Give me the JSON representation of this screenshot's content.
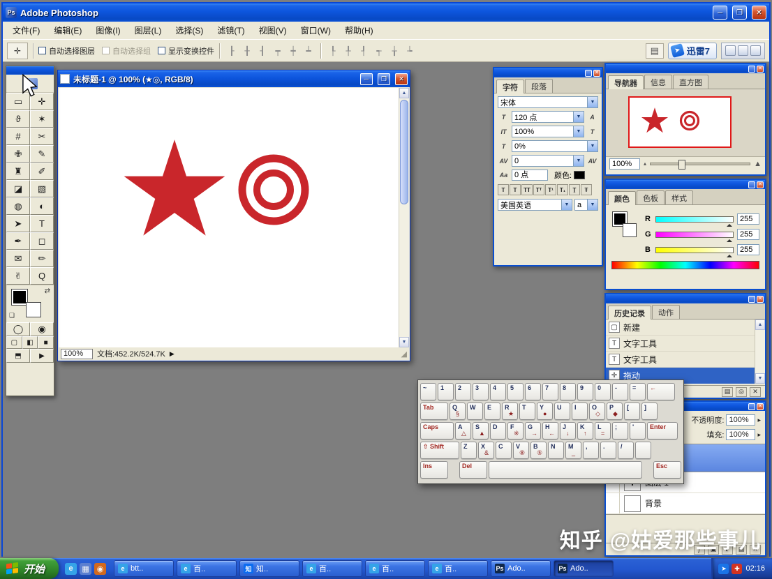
{
  "ui": {
    "up": "▲",
    "down": "▼",
    "right": "▶",
    "spin": "▸",
    "resize": "◢",
    "swap": "⇄",
    "reset": "❏",
    "dd": "▼"
  },
  "app": {
    "title": "Adobe Photoshop",
    "icon_label": "Ps",
    "minimize": "─",
    "restore": "❐",
    "close": "✕"
  },
  "menu": {
    "items": [
      "文件(F)",
      "编辑(E)",
      "图像(I)",
      "图层(L)",
      "选择(S)",
      "滤镜(T)",
      "视图(V)",
      "窗口(W)",
      "帮助(H)"
    ]
  },
  "options": {
    "tool_glyph": "✛",
    "checkboxes": [
      {
        "label": "自动选择图层"
      },
      {
        "label": "自动选择组",
        "cls": "disabled"
      },
      {
        "label": "显示变换控件"
      }
    ],
    "align_icons": [
      "┠",
      "╂",
      "┨",
      "┯",
      "┿",
      "┷"
    ],
    "dist_icons": [
      "┞",
      "╀",
      "┦",
      "┭",
      "╁",
      "┶"
    ],
    "browser_glyph": "▤",
    "thunder_label": "迅雷7",
    "thunder_logo": "➤"
  },
  "toolbox": {
    "tools": [
      {
        "name": "rectangular-marquee-tool",
        "glyph": "▭"
      },
      {
        "name": "move-tool",
        "glyph": "✛"
      },
      {
        "name": "lasso-tool",
        "glyph": "ϑ"
      },
      {
        "name": "magic-wand-tool",
        "glyph": "✶"
      },
      {
        "name": "crop-tool",
        "glyph": "#"
      },
      {
        "name": "slice-tool",
        "glyph": "✂"
      },
      {
        "name": "healing-brush-tool",
        "glyph": "✙"
      },
      {
        "name": "brush-tool",
        "glyph": "✎"
      },
      {
        "name": "clone-stamp-tool",
        "glyph": "♜"
      },
      {
        "name": "history-brush-tool",
        "glyph": "✐"
      },
      {
        "name": "eraser-tool",
        "glyph": "◪"
      },
      {
        "name": "gradient-tool",
        "glyph": "▧"
      },
      {
        "name": "blur-tool",
        "glyph": "◍"
      },
      {
        "name": "dodge-tool",
        "glyph": "◐"
      },
      {
        "name": "path-selection-tool",
        "glyph": "➤"
      },
      {
        "name": "type-tool",
        "glyph": "T"
      },
      {
        "name": "pen-tool",
        "glyph": "✒"
      },
      {
        "name": "shape-tool",
        "glyph": "◻"
      },
      {
        "name": "notes-tool",
        "glyph": "✉"
      },
      {
        "name": "eyedropper-tool",
        "glyph": "✏"
      },
      {
        "name": "hand-tool",
        "glyph": "✌"
      },
      {
        "name": "zoom-tool",
        "glyph": "Q"
      }
    ],
    "quickmask": [
      "◯",
      "◉"
    ],
    "screen_modes": [
      "▢",
      "◧",
      "■"
    ],
    "jump_buttons": [
      "⬒",
      "▶"
    ]
  },
  "document": {
    "title": "未标题-1 @ 100% (★◎, RGB/8)",
    "zoom": "100%",
    "status": "文档:452.2K/524.7K",
    "art_color": "#c9262b"
  },
  "char_panel": {
    "tabs": [
      {
        "label": "字符",
        "cls": "active"
      },
      {
        "label": "段落"
      }
    ],
    "font": "宋体",
    "size": "120 点",
    "v_scale": "100%",
    "h_scale": "0%",
    "tracking": "0",
    "baseline": "0 点",
    "color_label": "颜色:",
    "language": "美国英语",
    "styles": [
      "T",
      "T",
      "TT",
      "Tᵀ",
      "T¹",
      "T₁",
      "Ṯ",
      "Ŧ"
    ],
    "icons": {
      "size": "T",
      "size2": "A",
      "vscale": "IT",
      "vscale2": "T",
      "hscale": "T",
      "tracking": "AV",
      "tracking2": "AV",
      "baseline": "Aa",
      "aa": "a"
    }
  },
  "navigator": {
    "tabs": [
      {
        "label": "导航器",
        "cls": "active"
      },
      {
        "label": "信息"
      },
      {
        "label": "直方图"
      }
    ],
    "zoom": "100%",
    "zoom_out_icon": "▴",
    "zoom_in_icon": "▲"
  },
  "color_panel": {
    "tabs": [
      {
        "label": "颜色",
        "cls": "active"
      },
      {
        "label": "色板"
      },
      {
        "label": "样式"
      }
    ],
    "sliders": [
      {
        "label": "R",
        "value": "255",
        "grad": "linear-gradient(90deg,#00ffff,#ffffff)"
      },
      {
        "label": "G",
        "value": "255",
        "grad": "linear-gradient(90deg,#ff00ff,#ffffff)"
      },
      {
        "label": "B",
        "value": "255",
        "grad": "linear-gradient(90deg,#ffff00,#ffffff)"
      }
    ]
  },
  "history": {
    "tabs": [
      {
        "label": "历史记录",
        "cls": "active"
      },
      {
        "label": "动作"
      }
    ],
    "items": [
      {
        "icon": "▢",
        "label": "新建"
      },
      {
        "icon": "T",
        "label": "文字工具"
      },
      {
        "icon": "T",
        "label": "文字工具"
      },
      {
        "icon": "✛",
        "label": "拖动",
        "cls": "selected"
      }
    ],
    "footer": [
      {
        "name": "new-document-from-state-icon",
        "glyph": "▤"
      },
      {
        "name": "new-snapshot-icon",
        "glyph": "◎"
      },
      {
        "name": "delete-state-icon",
        "glyph": "✕"
      }
    ]
  },
  "layers": {
    "opacity_label": "不透明度:",
    "opacity": "100%",
    "fill_label": "填充:",
    "fill": "100%",
    "eye_icon": "◉",
    "rows": [
      {
        "thumb": "T",
        "name": "图层 1"
      },
      {
        "thumb": "",
        "name": "背景"
      }
    ],
    "footer": [
      {
        "name": "layer-style-icon",
        "glyph": "ƒ"
      },
      {
        "name": "layer-mask-icon",
        "glyph": "▣"
      },
      {
        "name": "adjustment-layer-icon",
        "glyph": "◐"
      },
      {
        "name": "new-layer-icon",
        "glyph": "▤"
      },
      {
        "name": "delete-layer-icon",
        "glyph": "✕"
      }
    ]
  },
  "keyboard": {
    "row0": [
      {
        "t": "~"
      },
      {
        "t": "1"
      },
      {
        "t": "2"
      },
      {
        "t": "3"
      },
      {
        "t": "4"
      },
      {
        "t": "5"
      },
      {
        "t": "6"
      },
      {
        "t": "7"
      },
      {
        "t": "8"
      },
      {
        "t": "9"
      },
      {
        "t": "0"
      },
      {
        "t": "-"
      },
      {
        "t": "="
      },
      {
        "t": "←",
        "cls": "mod wide"
      }
    ],
    "row1": [
      {
        "t": "Tab",
        "cls": "mod wide"
      },
      {
        "t": "Q",
        "s": "§"
      },
      {
        "t": "W"
      },
      {
        "t": "E"
      },
      {
        "t": "R",
        "s": "★"
      },
      {
        "t": "T"
      },
      {
        "t": "Y",
        "s": "●"
      },
      {
        "t": "U"
      },
      {
        "t": "I"
      },
      {
        "t": "O",
        "s": "◇"
      },
      {
        "t": "P",
        "s": "◆"
      },
      {
        "t": "["
      },
      {
        "t": "]"
      }
    ],
    "row2": [
      {
        "t": "Caps",
        "cls": "mod wider"
      },
      {
        "t": "A",
        "s": "△"
      },
      {
        "t": "S",
        "s": "▲"
      },
      {
        "t": "D"
      },
      {
        "t": "F",
        "s": "※"
      },
      {
        "t": "G",
        "s": "→"
      },
      {
        "t": "H",
        "s": "←"
      },
      {
        "t": "J",
        "s": "↓"
      },
      {
        "t": "K",
        "s": "↑"
      },
      {
        "t": "L",
        "s": "="
      },
      {
        "t": ";"
      },
      {
        "t": "'"
      },
      {
        "t": "Enter",
        "cls": "mod enter"
      }
    ],
    "row3": [
      {
        "t": "⇧ Shift",
        "cls": "mod shiftw"
      },
      {
        "t": "Z"
      },
      {
        "t": "X",
        "s": "&"
      },
      {
        "t": "C"
      },
      {
        "t": "V",
        "s": "⑧"
      },
      {
        "t": "B",
        "s": "⑤"
      },
      {
        "t": "N"
      },
      {
        "t": "M",
        "s": "_"
      },
      {
        "t": ","
      },
      {
        "t": "."
      },
      {
        "t": "/"
      },
      {
        "t": ""
      }
    ],
    "row4": [
      {
        "t": "Ins",
        "cls": "mod wide"
      },
      {
        "t": "Del",
        "cls": "mod wide gapl"
      },
      {
        "t": "",
        "cls": "space"
      },
      {
        "t": "Esc",
        "cls": "mod wide gapl"
      }
    ]
  },
  "taskbar": {
    "start": "开始",
    "quick_launch": [
      {
        "name": "ie-quicklaunch-icon",
        "glyph": "e",
        "bg": "#35a3e8"
      },
      {
        "name": "show-desktop-icon",
        "glyph": "▦",
        "bg": "#5b7fd0"
      },
      {
        "name": "media-player-icon",
        "glyph": "◉",
        "bg": "#d2691e"
      }
    ],
    "buttons": [
      {
        "icon": "e",
        "ibg": "#35a3e8",
        "label": "btt.."
      },
      {
        "icon": "e",
        "ibg": "#35a3e8",
        "label": "百.."
      },
      {
        "icon": "知",
        "ibg": "#0b6cf0",
        "label": "知.."
      },
      {
        "icon": "e",
        "ibg": "#35a3e8",
        "label": "百.."
      },
      {
        "icon": "e",
        "ibg": "#35a3e8",
        "label": "百.."
      },
      {
        "icon": "e",
        "ibg": "#35a3e8",
        "label": "百.."
      },
      {
        "icon": "Ps",
        "ibg": "#10284a",
        "label": "Ado.."
      },
      {
        "icon": "Ps",
        "ibg": "#10284a",
        "label": "Ado..",
        "cls": "active"
      }
    ],
    "tray_icons": [
      {
        "name": "thunder-tray-icon",
        "glyph": "➤",
        "bg": "#1a74e8"
      },
      {
        "name": "security-tray-icon",
        "glyph": "✚",
        "bg": "#d23322"
      }
    ],
    "clock": "02:16"
  },
  "watermark": {
    "brand": "知乎",
    "author": "@姑爱那些事儿"
  }
}
